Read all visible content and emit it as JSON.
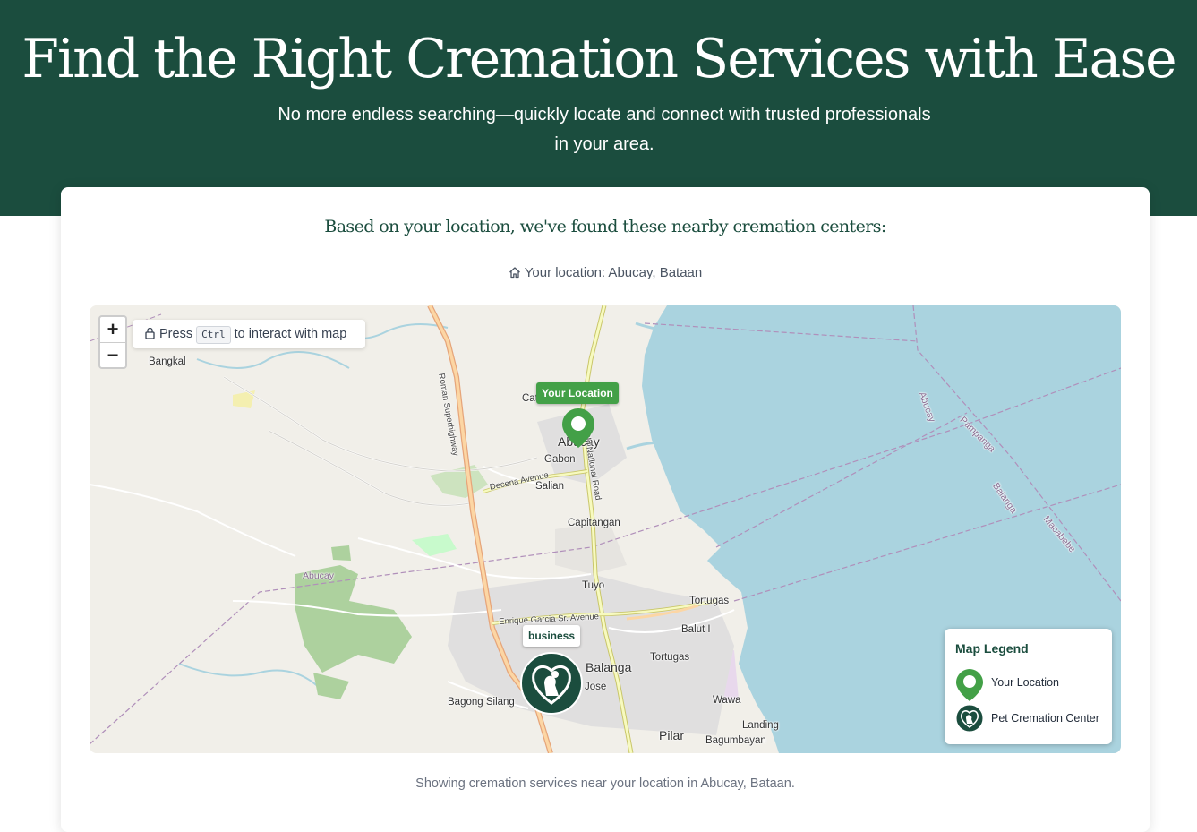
{
  "hero": {
    "title": "Find the Right Cremation Services with Ease",
    "subtitle_line1": "No more endless searching—quickly locate and connect with trusted professionals",
    "subtitle_line2": "in your area."
  },
  "results": {
    "heading": "Based on your location, we've found these nearby cremation centers:",
    "location_label": "Your location: Abucay, Bataan",
    "footer_note": "Showing cremation services near your location in Abucay, Bataan."
  },
  "map": {
    "zoom_in": "+",
    "zoom_out": "−",
    "hint_press": "Press",
    "hint_key": "Ctrl",
    "hint_rest": "to interact with map",
    "your_location_tag": "Your Location",
    "business_tag": "business",
    "places": {
      "bangkal": "Bangkal",
      "abucay": "Abucay",
      "gabon": "Gabon",
      "salian": "Salian",
      "capitangan": "Capitangan",
      "tuyo": "Tuyo",
      "tortugas1": "Tortugas",
      "tortugas2": "Tortugas",
      "balut": "Balut I",
      "balanga": "Balanga",
      "jose": "Jose",
      "bagong_silang": "Bagong Silang",
      "wawa": "Wawa",
      "landing": "Landing",
      "pilar": "Pilar",
      "bagumbayan": "Bagumbayan",
      "catr": "Catr",
      "abucay_admin": "Abucay"
    },
    "roads": {
      "roman": "Roman Superhighway",
      "old_national": "Old National Road",
      "decena": "Decena Avenue",
      "enrique": "Enrique Garcia Sr. Avenue"
    },
    "water_labels": {
      "abucay_bay": "Abucay",
      "pampanga": "Pampanga",
      "balanga_bay": "Balanga",
      "macabebe": "Macabebe"
    },
    "colors": {
      "water": "#aad3df",
      "land": "#f1efe9",
      "primary": "#1b4d3e",
      "your_location": "#43a047"
    }
  },
  "legend": {
    "title": "Map Legend",
    "items": [
      {
        "label": "Your Location",
        "icon": "location-pin-icon"
      },
      {
        "label": "Pet Cremation Center",
        "icon": "pet-cremation-icon"
      }
    ]
  }
}
